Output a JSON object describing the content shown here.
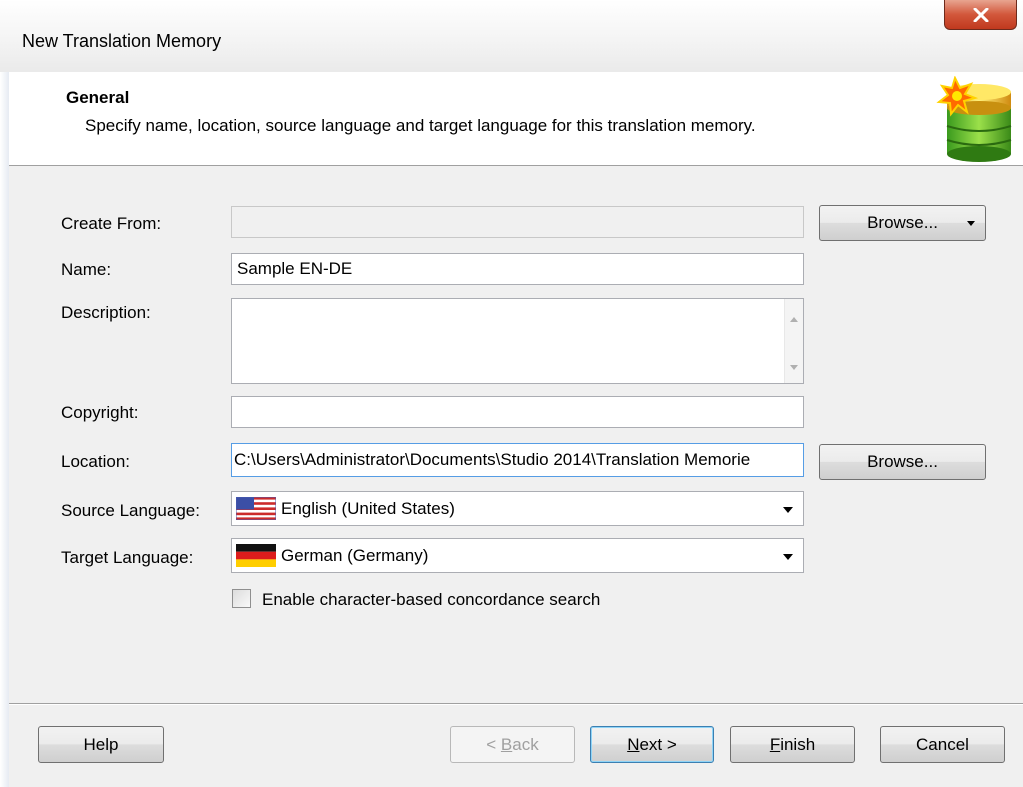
{
  "window": {
    "title": "New Translation Memory"
  },
  "header": {
    "title": "General",
    "description": "Specify name, location, source language and target language for this translation memory."
  },
  "form": {
    "create_from": {
      "label": "Create From:",
      "value": "",
      "button": "Browse..."
    },
    "name": {
      "label": "Name:",
      "value": "Sample EN-DE"
    },
    "description": {
      "label": "Description:",
      "value": ""
    },
    "copyright": {
      "label": "Copyright:",
      "value": ""
    },
    "location": {
      "label": "Location:",
      "value": "C:\\Users\\Administrator\\Documents\\Studio 2014\\Translation Memorie",
      "button": "Browse..."
    },
    "source_language": {
      "label": "Source Language:",
      "value": "English (United States)",
      "flag": "us-flag-icon"
    },
    "target_language": {
      "label": "Target Language:",
      "value": "German (Germany)",
      "flag": "de-flag-icon"
    },
    "concordance": {
      "label": "Enable character-based concordance search",
      "checked": false
    }
  },
  "footer": {
    "help": "Help",
    "back_u": "B",
    "back_rest": "ack",
    "back_prefix": "< ",
    "next_u": "N",
    "next_rest": "ext >",
    "finish_u": "F",
    "finish_rest": "inish",
    "cancel": "Cancel"
  },
  "colors": {
    "close_button": "#c0391e",
    "header_bg": "#ffffff",
    "client_bg": "#f0f0f0"
  }
}
